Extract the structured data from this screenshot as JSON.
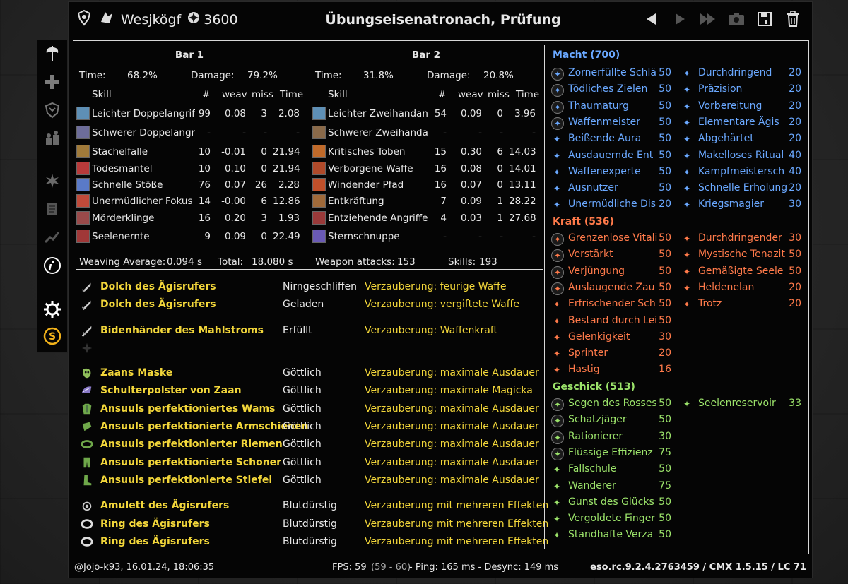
{
  "titlebar": {
    "player_name": "Wesjkögf",
    "cp_value": "3600",
    "fight_title": "Übungseisenatronach, Prüfung"
  },
  "bar1": {
    "title": "Bar 1",
    "time_label": "Time:",
    "time_value": "68.2%",
    "damage_label": "Damage:",
    "damage_value": "79.2%",
    "headers": {
      "skill": "Skill",
      "count": "#",
      "weav": "weav",
      "miss": "miss",
      "time": "Time"
    },
    "skills": [
      {
        "name": "Leichter Doppelangrif",
        "count": "99",
        "weav": "0.08",
        "miss": "3",
        "time": "2.08",
        "color": "#5e8fb5"
      },
      {
        "name": "Schwerer Doppelangr",
        "count": "-",
        "weav": "-",
        "miss": "-",
        "time": "-",
        "color": "#6d6d9a"
      },
      {
        "name": "Stachelfalle",
        "count": "10",
        "weav": "-0.01",
        "miss": "0",
        "time": "21.94",
        "color": "#a07a3a"
      },
      {
        "name": "Todesmantel",
        "count": "10",
        "weav": "0.10",
        "miss": "0",
        "time": "21.94",
        "color": "#b83a3a"
      },
      {
        "name": "Schnelle Stöße",
        "count": "76",
        "weav": "0.07",
        "miss": "26",
        "time": "2.28",
        "color": "#5a7ac8"
      },
      {
        "name": "Unermüdlicher Fokus",
        "count": "14",
        "weav": "-0.00",
        "miss": "6",
        "time": "12.86",
        "color": "#c04a3a"
      },
      {
        "name": "Mörderklinge",
        "count": "16",
        "weav": "0.20",
        "miss": "3",
        "time": "1.93",
        "color": "#9a4a4a"
      },
      {
        "name": "Seelenernte",
        "count": "9",
        "weav": "0.09",
        "miss": "0",
        "time": "22.49",
        "color": "#a03838"
      }
    ],
    "footer_label": "Weaving Average:",
    "footer_value": "0.094 s",
    "total_label": "Total:",
    "total_value": "18.080 s"
  },
  "bar2": {
    "title": "Bar 2",
    "time_label": "Time:",
    "time_value": "31.8%",
    "damage_label": "Damage:",
    "damage_value": "20.8%",
    "headers": {
      "skill": "Skill",
      "count": "#",
      "weav": "weav",
      "miss": "miss",
      "time": "Time"
    },
    "skills": [
      {
        "name": "Leichter Zweihandan",
        "count": "54",
        "weav": "0.09",
        "miss": "0",
        "time": "3.96",
        "color": "#5e8fb5"
      },
      {
        "name": "Schwerer Zweihanda",
        "count": "-",
        "weav": "-",
        "miss": "-",
        "time": "-",
        "color": "#8a6a4a"
      },
      {
        "name": "Kritisches Toben",
        "count": "15",
        "weav": "0.30",
        "miss": "6",
        "time": "14.03",
        "color": "#c06a2a"
      },
      {
        "name": "Verborgene Waffe",
        "count": "16",
        "weav": "0.08",
        "miss": "0",
        "time": "14.01",
        "color": "#b04a2a"
      },
      {
        "name": "Windender Pfad",
        "count": "16",
        "weav": "0.07",
        "miss": "0",
        "time": "13.11",
        "color": "#c0502a"
      },
      {
        "name": "Entkräftung",
        "count": "7",
        "weav": "0.09",
        "miss": "1",
        "time": "28.22",
        "color": "#a06a3a"
      },
      {
        "name": "Entziehende Angriffe",
        "count": "4",
        "weav": "0.03",
        "miss": "1",
        "time": "27.68",
        "color": "#9a3a3a"
      },
      {
        "name": "Sternschnuppe",
        "count": "-",
        "weav": "-",
        "miss": "-",
        "time": "-",
        "color": "#6a5ab5"
      }
    ],
    "footer_label": "Weapon attacks:",
    "footer_value": "153",
    "total_label": "Skills:",
    "total_value": "193"
  },
  "gear": [
    {
      "name": "Dolch des Ägisrufers",
      "trait": "Nirngeschliffen",
      "ench": "Verzauberung: feurige Waffe",
      "icon": "dagger-icon"
    },
    {
      "name": "Dolch des Ägisrufers",
      "trait": "Geladen",
      "ench": "Verzauberung: vergiftete Waffe",
      "icon": "dagger-icon"
    },
    {
      "name": "Bidenhänder des Mahlstroms",
      "trait": "Erfüllt",
      "ench": "Verzauberung: Waffenkraft",
      "icon": "greatsword-icon"
    },
    {
      "name": "Zaans Maske",
      "trait": "Göttlich",
      "ench": "Verzauberung: maximale Ausdauer",
      "icon": "mask-icon"
    },
    {
      "name": "Schulterpolster von Zaan",
      "trait": "Göttlich",
      "ench": "Verzauberung: maximale Magicka",
      "icon": "shoulder-icon"
    },
    {
      "name": "Ansuuls perfektioniertes Wams",
      "trait": "Göttlich",
      "ench": "Verzauberung: maximale Ausdauer",
      "icon": "chest-icon"
    },
    {
      "name": "Ansuuls perfektionierte Armschienen",
      "trait": "Göttlich",
      "ench": "Verzauberung: maximale Ausdauer",
      "icon": "bracers-icon"
    },
    {
      "name": "Ansuuls perfektionierter Riemen",
      "trait": "Göttlich",
      "ench": "Verzauberung: maximale Ausdauer",
      "icon": "belt-icon"
    },
    {
      "name": "Ansuuls perfektionierte Schoner",
      "trait": "Göttlich",
      "ench": "Verzauberung: maximale Ausdauer",
      "icon": "legs-icon"
    },
    {
      "name": "Ansuuls perfektionierte Stiefel",
      "trait": "Göttlich",
      "ench": "Verzauberung: maximale Ausdauer",
      "icon": "boots-icon"
    },
    {
      "name": "Amulett des Ägisrufers",
      "trait": "Blutdürstig",
      "ench": "Verzauberung mit mehreren Effekten",
      "icon": "amulet-icon"
    },
    {
      "name": "Ring des Ägisrufers",
      "trait": "Blutdürstig",
      "ench": "Verzauberung mit mehreren Effekten",
      "icon": "ring-icon"
    },
    {
      "name": "Ring des Ägisrufers",
      "trait": "Blutdürstig",
      "ench": "Verzauberung mit mehreren Effekten",
      "icon": "ring-icon"
    }
  ],
  "cp": {
    "macht_title": "Macht (700)",
    "macht_left": [
      {
        "name": "Zornerfüllte Schlä",
        "val": "50",
        "slotted": true
      },
      {
        "name": "Tödliches Zielen",
        "val": "50",
        "slotted": true
      },
      {
        "name": "Thaumaturg",
        "val": "50",
        "slotted": true
      },
      {
        "name": "Waffenmeister",
        "val": "50",
        "slotted": true
      },
      {
        "name": "Beißende Aura",
        "val": "50",
        "slotted": false
      },
      {
        "name": "Ausdauernde Ent",
        "val": "50",
        "slotted": false
      },
      {
        "name": "Waffenexperte",
        "val": "50",
        "slotted": false
      },
      {
        "name": "Ausnutzer",
        "val": "50",
        "slotted": false
      },
      {
        "name": "Unermüdliche Dis",
        "val": "20",
        "slotted": false
      }
    ],
    "macht_right": [
      {
        "name": "Durchdringend",
        "val": "20"
      },
      {
        "name": "Präzision",
        "val": "20"
      },
      {
        "name": "Vorbereitung",
        "val": "20"
      },
      {
        "name": "Elementare Ägis",
        "val": "20"
      },
      {
        "name": "Abgehärtet",
        "val": "20"
      },
      {
        "name": "Makelloses Ritual",
        "val": "40"
      },
      {
        "name": "Kampfmeistersch",
        "val": "40"
      },
      {
        "name": "Schnelle Erholung",
        "val": "20"
      },
      {
        "name": "Kriegsmagier",
        "val": "30"
      }
    ],
    "kraft_title": "Kraft (536)",
    "kraft_left": [
      {
        "name": "Grenzenlose Vitali",
        "val": "50",
        "slotted": true
      },
      {
        "name": "Verstärkt",
        "val": "50",
        "slotted": true
      },
      {
        "name": "Verjüngung",
        "val": "50",
        "slotted": true
      },
      {
        "name": "Auslaugende Zau",
        "val": "50",
        "slotted": true
      },
      {
        "name": "Erfrischender Sch",
        "val": "50",
        "slotted": false
      },
      {
        "name": "Bestand durch Lei",
        "val": "50",
        "slotted": false
      },
      {
        "name": "Gelenkigkeit",
        "val": "30",
        "slotted": false
      },
      {
        "name": "Sprinter",
        "val": "20",
        "slotted": false
      },
      {
        "name": "Hastig",
        "val": "16",
        "slotted": false
      }
    ],
    "kraft_right": [
      {
        "name": "Durchdringender",
        "val": "30"
      },
      {
        "name": "Mystische Tenazit",
        "val": "50"
      },
      {
        "name": "Gemäßigte Seele",
        "val": "50"
      },
      {
        "name": "Heldenelan",
        "val": "20"
      },
      {
        "name": "Trotz",
        "val": "20"
      }
    ],
    "geschick_title": "Geschick (513)",
    "geschick_left": [
      {
        "name": "Segen des Rosses",
        "val": "50",
        "slotted": true
      },
      {
        "name": "Schatzjäger",
        "val": "50",
        "slotted": true
      },
      {
        "name": "Rationierer",
        "val": "30",
        "slotted": true
      },
      {
        "name": "Flüssige Effizienz",
        "val": "75",
        "slotted": true
      },
      {
        "name": "Fallschule",
        "val": "50",
        "slotted": false
      },
      {
        "name": "Wanderer",
        "val": "75",
        "slotted": false
      },
      {
        "name": "Gunst des Glücks",
        "val": "50",
        "slotted": false
      },
      {
        "name": "Vergoldete Finger",
        "val": "50",
        "slotted": false
      },
      {
        "name": "Standhafte Verza",
        "val": "50",
        "slotted": false
      }
    ],
    "geschick_right": [
      {
        "name": "Seelenreservoir",
        "val": "33"
      }
    ]
  },
  "footer": {
    "user_date": "@Jojo-k93, 16.01.24, 18:06:35",
    "fps_label": "FPS: 59",
    "fps_range": "(59 - 60)",
    "ping": "- Ping: 165 ms - Desync: 149 ms",
    "version": "eso.rc.9.2.4.2763459 / CMX 1.5.15 / LC 71"
  },
  "colors": {
    "gear_name": "#f2d63a",
    "macht": "#6aa8ff",
    "kraft": "#ff7a4a",
    "geschick": "#9be26a"
  }
}
